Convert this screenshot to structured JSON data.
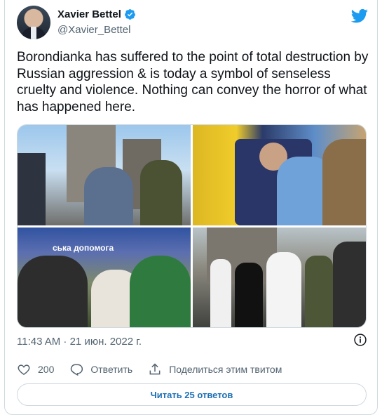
{
  "author": {
    "display_name": "Xavier Bettel",
    "handle": "@Xavier_Bettel",
    "avatar_icon": "profile-photo",
    "verified": true
  },
  "tweet": {
    "text": "Borondianka has suffered to the point of total destruction by Russian aggression & is today a symbol of senseless cruelty and violence. Nothing can convey the horror of what has happened here."
  },
  "media": {
    "count": 4,
    "photos": [
      "photo-1",
      "photo-2",
      "photo-3",
      "photo-4"
    ],
    "photo3_banner_text": "ська допомога"
  },
  "meta": {
    "timestamp": "11:43 AM · 21 июн. 2022 г."
  },
  "actions": {
    "likes_count": "200",
    "reply_label": "Ответить",
    "share_label": "Поделиться этим твитом"
  },
  "read_replies_label": "Читать 25 ответов",
  "colors": {
    "brand": "#1d9bf0",
    "text": "#0f1419",
    "secondary": "#536471",
    "border": "#cfd9de"
  }
}
